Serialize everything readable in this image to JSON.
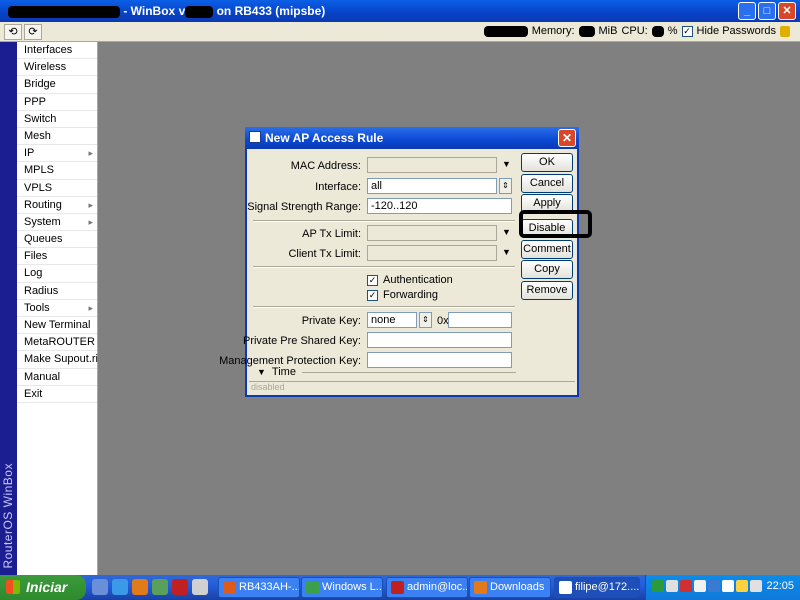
{
  "window": {
    "title_prefix": "- WinBox v",
    "title_suffix": "on RB433 (mipsbe)",
    "btn_min": "_",
    "btn_max": "□",
    "btn_close": "✕"
  },
  "toolbar": {
    "undo": "⟲",
    "redo": "⟳",
    "memory_label": "Memory:",
    "memory_unit": "MiB",
    "cpu_label": "CPU:",
    "cpu_unit": "%",
    "hide_passwords_label": "Hide Passwords",
    "hide_passwords_checked": "✓"
  },
  "sidebar": {
    "brand": "RouterOS WinBox",
    "items": [
      {
        "label": "Interfaces",
        "arrow": ""
      },
      {
        "label": "Wireless",
        "arrow": ""
      },
      {
        "label": "Bridge",
        "arrow": ""
      },
      {
        "label": "PPP",
        "arrow": ""
      },
      {
        "label": "Switch",
        "arrow": ""
      },
      {
        "label": "Mesh",
        "arrow": ""
      },
      {
        "label": "IP",
        "arrow": "▸"
      },
      {
        "label": "MPLS",
        "arrow": ""
      },
      {
        "label": "VPLS",
        "arrow": ""
      },
      {
        "label": "Routing",
        "arrow": "▸"
      },
      {
        "label": "System",
        "arrow": "▸"
      },
      {
        "label": "Queues",
        "arrow": ""
      },
      {
        "label": "Files",
        "arrow": ""
      },
      {
        "label": "Log",
        "arrow": ""
      },
      {
        "label": "Radius",
        "arrow": ""
      },
      {
        "label": "Tools",
        "arrow": "▸"
      },
      {
        "label": "New Terminal",
        "arrow": ""
      },
      {
        "label": "MetaROUTER",
        "arrow": ""
      },
      {
        "label": "Make Supout.rif",
        "arrow": ""
      },
      {
        "label": "Manual",
        "arrow": ""
      },
      {
        "label": "Exit",
        "arrow": ""
      }
    ]
  },
  "dialog": {
    "title": "New AP Access Rule",
    "close": "✕",
    "fields": {
      "mac_label": "MAC Address:",
      "mac_value": "",
      "interface_label": "Interface:",
      "interface_value": "all",
      "signal_label": "Signal Strength Range:",
      "signal_value": "-120..120",
      "ap_tx_label": "AP Tx Limit:",
      "ap_tx_value": "",
      "client_tx_label": "Client Tx Limit:",
      "client_tx_value": "",
      "authentication_label": "Authentication",
      "authentication_checked": "✓",
      "forwarding_label": "Forwarding",
      "forwarding_checked": "✓",
      "private_key_label": "Private Key:",
      "private_key_value": "none",
      "private_key_prefix": "0x",
      "private_key_hex": "",
      "psk_label": "Private Pre Shared Key:",
      "psk_value": "",
      "mgmt_label": "Management Protection Key:",
      "mgmt_value": "",
      "time_label": "Time",
      "time_arrow": "▼"
    },
    "buttons": {
      "ok": "OK",
      "cancel": "Cancel",
      "apply": "Apply",
      "disable": "Disable",
      "comment": "Comment",
      "copy": "Copy",
      "remove": "Remove"
    },
    "status": "disabled",
    "dropdown_arrow": "▼",
    "spin_arrow": "⇕"
  },
  "taskbar": {
    "start": "Iniciar",
    "tasks": [
      {
        "label": "RB433AH-...",
        "color": "#e05a1a"
      },
      {
        "label": "Windows L...",
        "color": "#3aa04a"
      },
      {
        "label": "admin@loc...",
        "color": "#c02020"
      },
      {
        "label": "Downloads",
        "color": "#e07a1a"
      },
      {
        "label": "filipe@172....",
        "color": "#ffffff"
      }
    ],
    "clock": "22:05"
  }
}
